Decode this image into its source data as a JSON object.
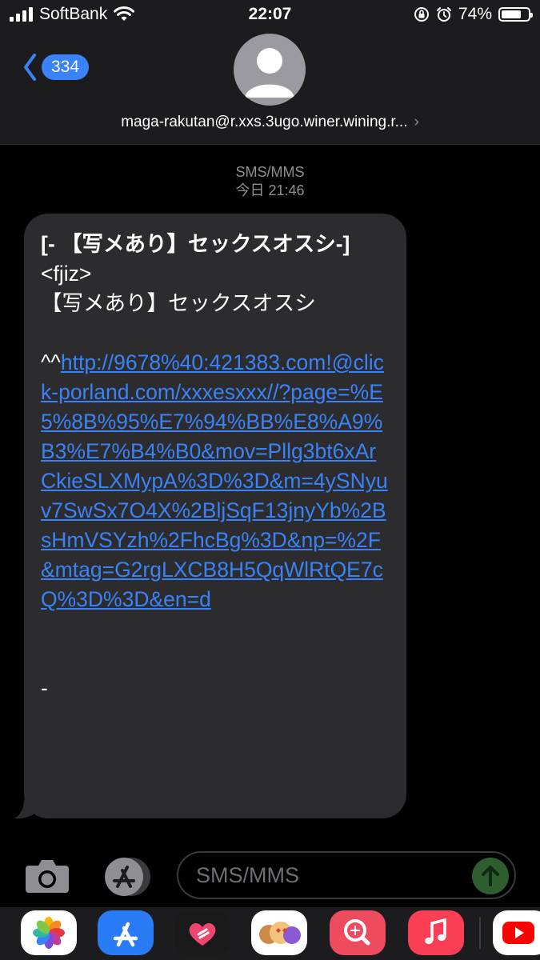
{
  "status_bar": {
    "carrier": "SoftBank",
    "time": "22:07",
    "battery_percent": "74%",
    "battery_level": 0.74,
    "icons": [
      "cellular-signal-icon",
      "wifi-icon",
      "orientation-lock-icon",
      "alarm-icon",
      "battery-icon"
    ]
  },
  "header": {
    "back_count": "334",
    "contact": "maga-rakutan@r.xxs.3ugo.winer.wining.r...",
    "avatar_icon": "person-icon"
  },
  "conversation": {
    "service": "SMS/MMS",
    "timestamp": "今日 21:46"
  },
  "message": {
    "title": "[- 【写メあり】セックスオスシ-]",
    "line_tag": "<fjiz>",
    "line_subject": "【写メあり】セックスオスシ",
    "link_prefix": "^^",
    "link_text": "http://9678%40:421383.com!@click-porland.com/xxxesxxx//?page=%E5%8B%95%E7%94%BB%E8%A9%B3%E7%B4%B0&mov=Pllg3bt6xArCkieSLXMypA%3D%3D&m=4ySNyuv7SwSx7O4X%2BljSqF13jnyYb%2BsHmVSYzh%2FhcBg%3D&np=%2F&mtag=G2rgLXCB8H5QqWlRtQE7cQ%3D%3D&en=d",
    "footer": "-"
  },
  "input_bar": {
    "placeholder": "SMS/MMS",
    "icons": [
      "camera-icon",
      "app-store-icon",
      "send-arrow-icon"
    ]
  },
  "app_drawer": {
    "apps": [
      "photos-app-icon",
      "app-store-app-icon",
      "digital-touch-app-icon",
      "memoji-stickers-app-icon",
      "images-search-app-icon",
      "music-app-icon",
      "youtube-app-icon"
    ]
  },
  "colors": {
    "accent_blue": "#3a82f7",
    "bubble_bg": "#2c2c2e",
    "header_bg": "#1c1c1e",
    "send_green": "#2e5e30"
  }
}
